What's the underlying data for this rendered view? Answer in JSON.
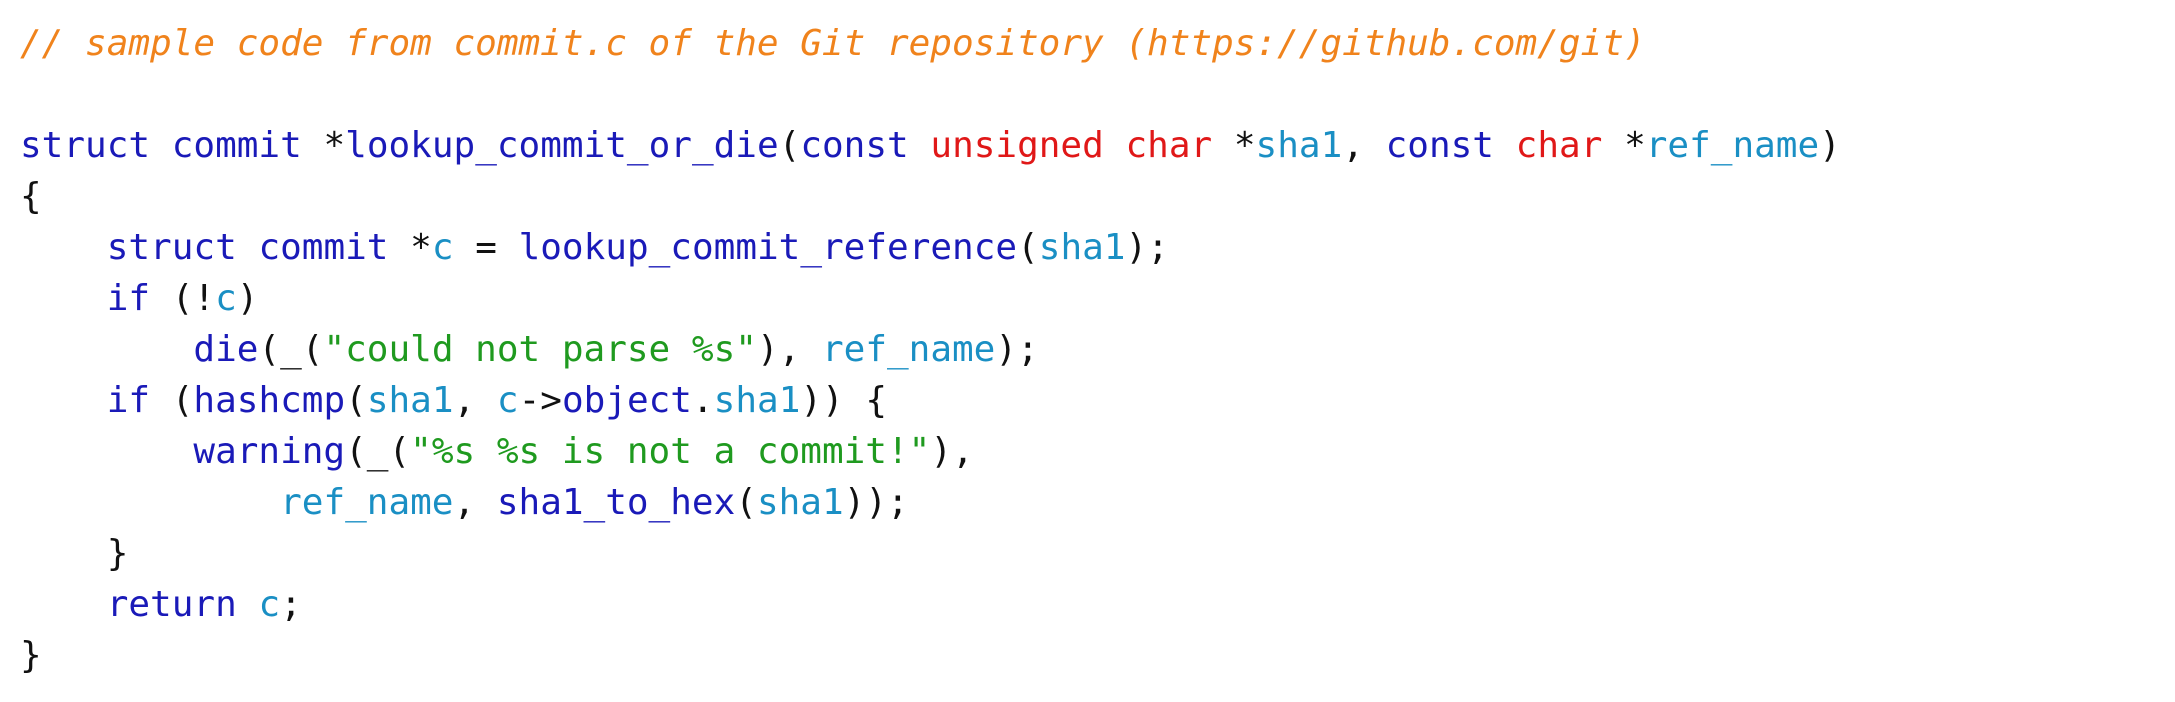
{
  "colors": {
    "comment": "#f0831c",
    "keyword": "#1a1ab8",
    "type": "#e01818",
    "identifier": "#1a8fc4",
    "function": "#1a1ab8",
    "string": "#1f9a1f",
    "punctuation": "#111111"
  },
  "code_lines": [
    [
      {
        "t": "comment",
        "v": "// sample code from commit.c of the Git repository (https://github.com/git)"
      }
    ],
    [],
    [
      {
        "t": "keyword",
        "v": "struct"
      },
      {
        "t": "plain",
        "v": " "
      },
      {
        "t": "keyword",
        "v": "commit"
      },
      {
        "t": "plain",
        "v": " "
      },
      {
        "t": "punct",
        "v": "*"
      },
      {
        "t": "func",
        "v": "lookup_commit_or_die"
      },
      {
        "t": "punct",
        "v": "("
      },
      {
        "t": "keyword",
        "v": "const"
      },
      {
        "t": "plain",
        "v": " "
      },
      {
        "t": "type",
        "v": "unsigned"
      },
      {
        "t": "plain",
        "v": " "
      },
      {
        "t": "type",
        "v": "char"
      },
      {
        "t": "plain",
        "v": " "
      },
      {
        "t": "punct",
        "v": "*"
      },
      {
        "t": "ident",
        "v": "sha1"
      },
      {
        "t": "punct",
        "v": ", "
      },
      {
        "t": "keyword",
        "v": "const"
      },
      {
        "t": "plain",
        "v": " "
      },
      {
        "t": "type",
        "v": "char"
      },
      {
        "t": "plain",
        "v": " "
      },
      {
        "t": "punct",
        "v": "*"
      },
      {
        "t": "ident",
        "v": "ref_name"
      },
      {
        "t": "punct",
        "v": ")"
      }
    ],
    [
      {
        "t": "punct",
        "v": "{"
      }
    ],
    [
      {
        "t": "plain",
        "v": "    "
      },
      {
        "t": "keyword",
        "v": "struct"
      },
      {
        "t": "plain",
        "v": " "
      },
      {
        "t": "keyword",
        "v": "commit"
      },
      {
        "t": "plain",
        "v": " "
      },
      {
        "t": "punct",
        "v": "*"
      },
      {
        "t": "ident",
        "v": "c"
      },
      {
        "t": "punct",
        "v": " = "
      },
      {
        "t": "func",
        "v": "lookup_commit_reference"
      },
      {
        "t": "punct",
        "v": "("
      },
      {
        "t": "ident",
        "v": "sha1"
      },
      {
        "t": "punct",
        "v": ");"
      }
    ],
    [
      {
        "t": "plain",
        "v": "    "
      },
      {
        "t": "keyword",
        "v": "if"
      },
      {
        "t": "punct",
        "v": " (!"
      },
      {
        "t": "ident",
        "v": "c"
      },
      {
        "t": "punct",
        "v": ")"
      }
    ],
    [
      {
        "t": "plain",
        "v": "        "
      },
      {
        "t": "func",
        "v": "die"
      },
      {
        "t": "punct",
        "v": "(_("
      },
      {
        "t": "string",
        "v": "\"could not parse %s\""
      },
      {
        "t": "punct",
        "v": "), "
      },
      {
        "t": "ident",
        "v": "ref_name"
      },
      {
        "t": "punct",
        "v": ");"
      }
    ],
    [
      {
        "t": "plain",
        "v": "    "
      },
      {
        "t": "keyword",
        "v": "if"
      },
      {
        "t": "punct",
        "v": " ("
      },
      {
        "t": "func",
        "v": "hashcmp"
      },
      {
        "t": "punct",
        "v": "("
      },
      {
        "t": "ident",
        "v": "sha1"
      },
      {
        "t": "punct",
        "v": ", "
      },
      {
        "t": "ident",
        "v": "c"
      },
      {
        "t": "punct",
        "v": "->"
      },
      {
        "t": "func",
        "v": "object"
      },
      {
        "t": "punct",
        "v": "."
      },
      {
        "t": "ident",
        "v": "sha1"
      },
      {
        "t": "punct",
        "v": ")) {"
      }
    ],
    [
      {
        "t": "plain",
        "v": "        "
      },
      {
        "t": "func",
        "v": "warning"
      },
      {
        "t": "punct",
        "v": "(_("
      },
      {
        "t": "string",
        "v": "\"%s %s is not a commit!\""
      },
      {
        "t": "punct",
        "v": "),"
      }
    ],
    [
      {
        "t": "plain",
        "v": "            "
      },
      {
        "t": "ident",
        "v": "ref_name"
      },
      {
        "t": "punct",
        "v": ", "
      },
      {
        "t": "func",
        "v": "sha1_to_hex"
      },
      {
        "t": "punct",
        "v": "("
      },
      {
        "t": "ident",
        "v": "sha1"
      },
      {
        "t": "punct",
        "v": "));"
      }
    ],
    [
      {
        "t": "plain",
        "v": "    "
      },
      {
        "t": "punct",
        "v": "}"
      }
    ],
    [
      {
        "t": "plain",
        "v": "    "
      },
      {
        "t": "keyword",
        "v": "return"
      },
      {
        "t": "plain",
        "v": " "
      },
      {
        "t": "ident",
        "v": "c"
      },
      {
        "t": "punct",
        "v": ";"
      }
    ],
    [
      {
        "t": "punct",
        "v": "}"
      }
    ]
  ]
}
